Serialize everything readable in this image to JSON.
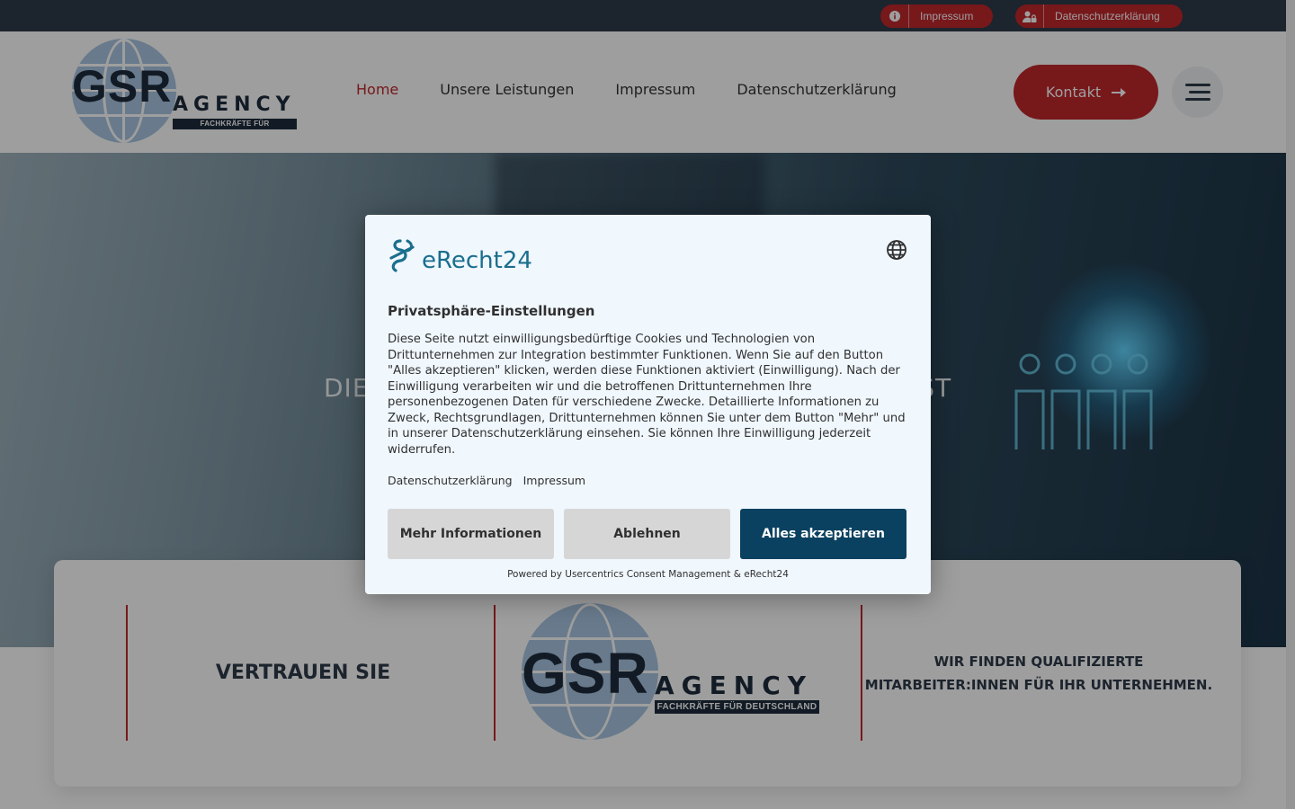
{
  "topbar": {
    "impressum_label": "Impressum",
    "datenschutz_label": "Datenschutzerklärung"
  },
  "logo": {
    "main": "GSR",
    "agency": "AGENCY",
    "tagline": "FACHKRÄFTE FÜR DEUTSCHLAND"
  },
  "nav": {
    "items": [
      {
        "label": "Home",
        "active": true
      },
      {
        "label": "Unsere Leistungen",
        "active": false
      },
      {
        "label": "Impressum",
        "active": false
      },
      {
        "label": "Datenschutzerklärung",
        "active": false
      }
    ],
    "cta_label": "Kontakt",
    "cta_icon": "arrow-right-icon"
  },
  "hero": {
    "text_left": "DIE",
    "text_right": "IST"
  },
  "info_card": {
    "left_text": "VERTRAUEN SIE",
    "right_text": "WIR FINDEN QUALIFIZIERTE MITARBEITER:INNEN FÜR IHR UNTERNEHMEN."
  },
  "consent": {
    "brand": "eRecht24",
    "title": "Privatsphäre-Einstellungen",
    "body": "Diese Seite nutzt einwilligungsbedürftige Cookies und Technologien von Drittunternehmen zur Integration bestimmter Funktionen. Wenn Sie auf den Button \"Alles akzeptieren\" klicken, werden diese Funktionen aktiviert (Einwilligung). Nach der Einwilligung verarbeiten wir und die betroffenen Drittunternehmen Ihre personenbezogenen Daten für verschiedene Zwecke. Detaillierte Informationen zu Zweck, Rechtsgrundlagen, Drittunternehmen können Sie unter dem Button \"Mehr\" und in unserer Datenschutzerklärung einsehen. Sie können Ihre Einwilligung jederzeit widerrufen.",
    "link_privacy": "Datenschutzerklärung",
    "link_imprint": "Impressum",
    "btn_more": "Mehr Informationen",
    "btn_decline": "Ablehnen",
    "btn_accept": "Alles akzeptieren",
    "powered_by": "Powered by Usercentrics Consent Management & eRecht24"
  },
  "colors": {
    "accent_red": "#c0272d",
    "topbar": "#2e3a49",
    "consent_primary": "#0b4160",
    "consent_bg": "#f0f7fd"
  }
}
